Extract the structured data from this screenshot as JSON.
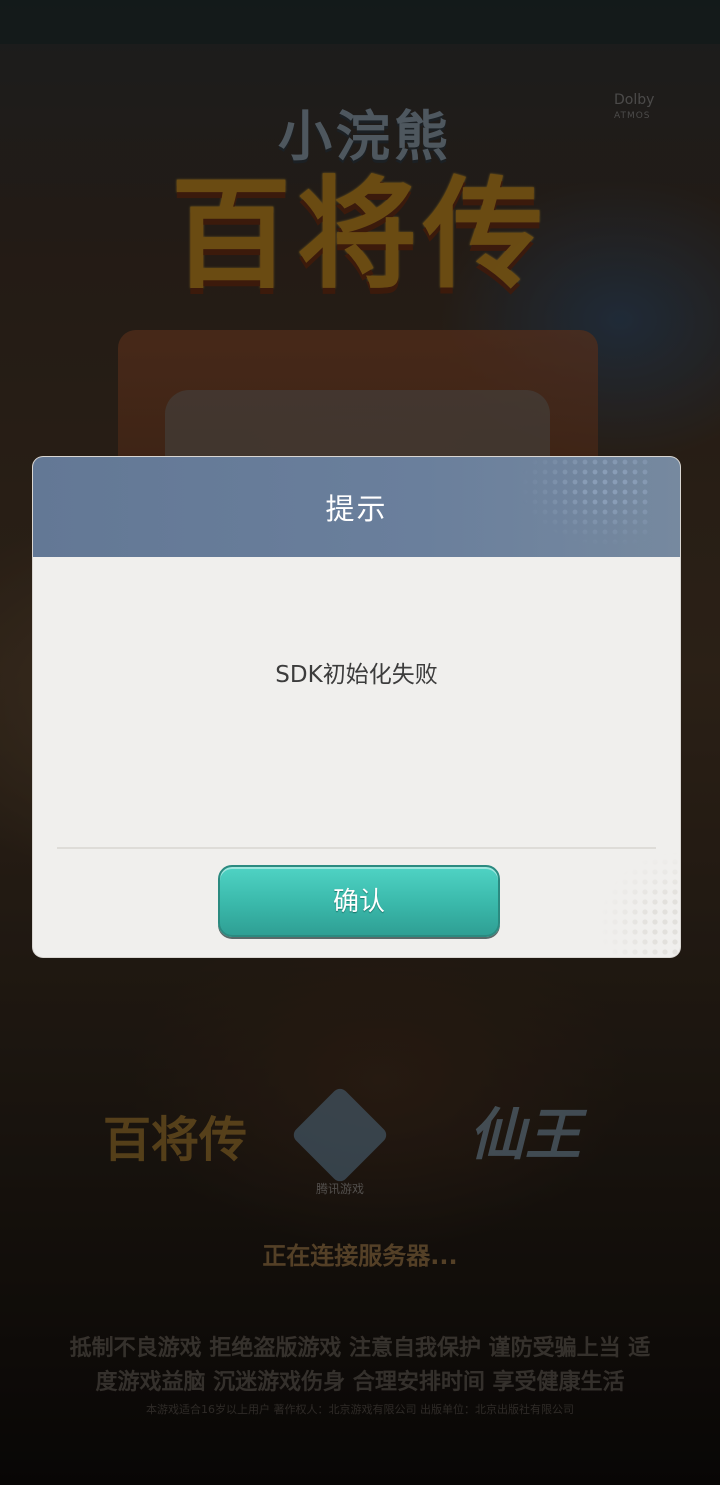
{
  "background": {
    "dolby": {
      "brand": "Dolby",
      "sub": "ATMOS"
    },
    "game_logo": {
      "top": "小浣熊",
      "main": "百将传"
    },
    "footer_logos": {
      "left": "百将传",
      "center": "腾讯游戏",
      "right": "仙王"
    },
    "loading_text": "正在连接服务器...",
    "health_notice": "抵制不良游戏 拒绝盗版游戏 注意自我保护 谨防受骗上当 适度游戏益脑 沉迷游戏伤身 合理安排时间 享受健康生活",
    "fine_print": "本游戏适合16岁以上用户 著作权人：北京游戏有限公司 出版单位：北京出版社有限公司"
  },
  "dialog": {
    "title": "提示",
    "message": "SDK初始化失败",
    "confirm_label": "确认"
  },
  "colors": {
    "header": "#6a7f9c",
    "button": "#3ab8aa",
    "dialog_bg": "#f0efed"
  }
}
